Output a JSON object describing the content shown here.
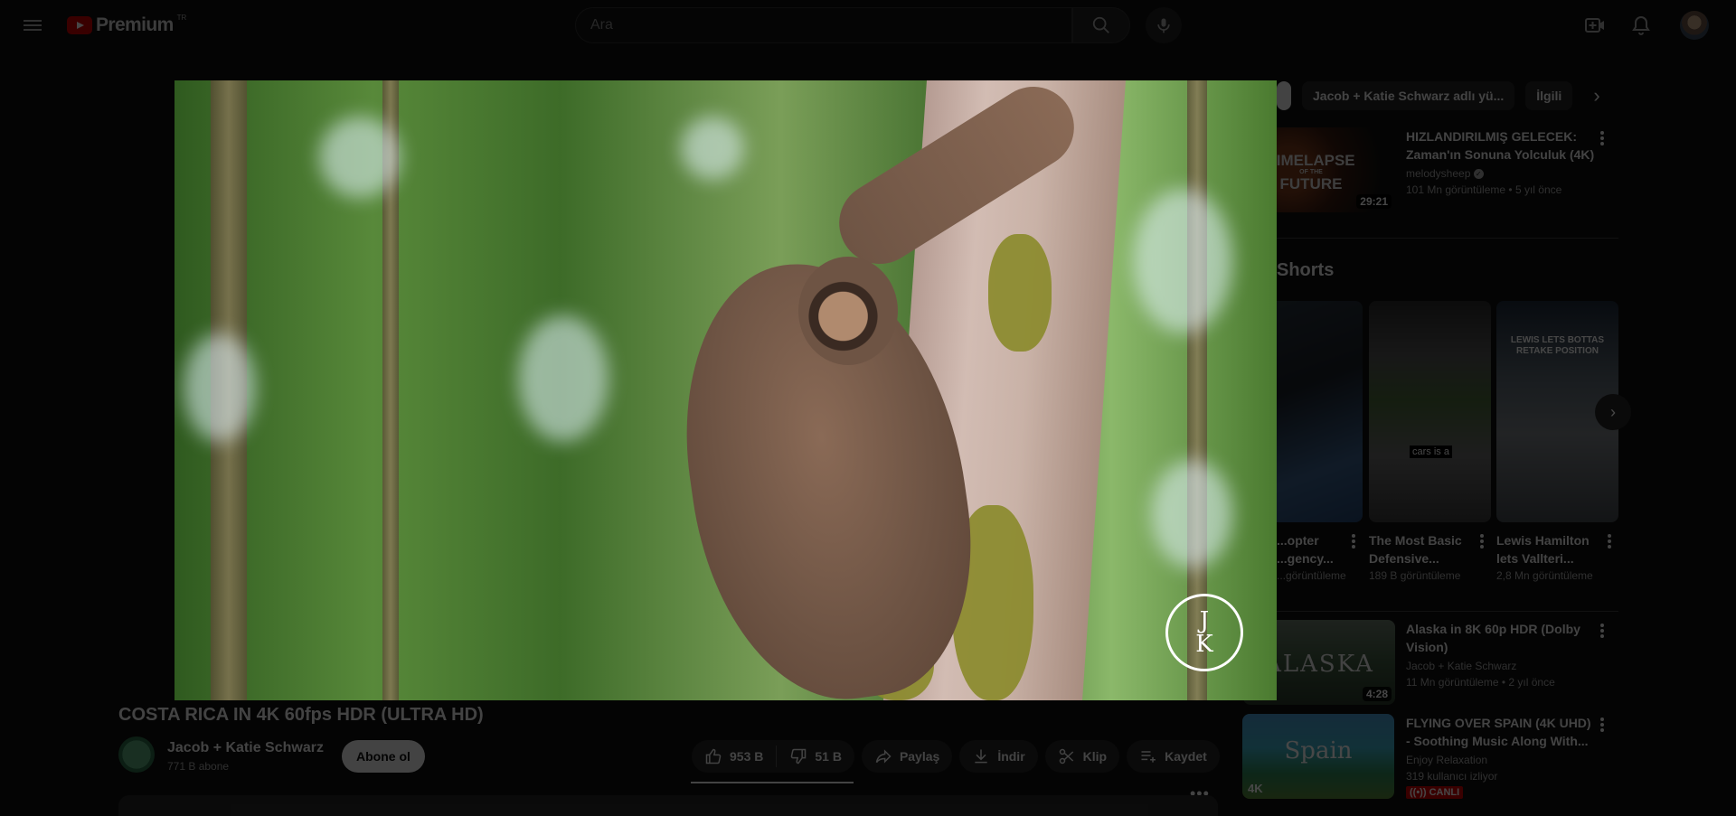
{
  "header": {
    "logo_text": "Premium",
    "logo_country": "TR",
    "search_placeholder": "Ara",
    "icons": [
      "menu-icon",
      "search-icon",
      "mic-icon",
      "create-icon",
      "bell-icon",
      "avatar"
    ]
  },
  "chips": [
    "Jacob + Katie Schwarz adlı yü...",
    "İlgili"
  ],
  "recommendations": [
    {
      "title": "HIZLANDIRILMIŞ GELECEK: Zaman'ın Sonuna Yolculuk (4K)",
      "thumb_text_1": "TIMELAPSE",
      "thumb_text_2": "OF THE",
      "thumb_text_3": "FUTURE",
      "channel": "melodysheep",
      "verified": true,
      "views": "101 Mn görüntüleme",
      "age": "5 yıl önce",
      "duration": "29:21"
    },
    {
      "title": "Alaska in 8K 60p HDR (Dolby Vision)",
      "thumb_text": "ALASKA",
      "channel": "Jacob + Katie Schwarz",
      "views": "11 Mn görüntüleme",
      "age": "2 yıl önce",
      "duration": "4:28"
    },
    {
      "title": "FLYING OVER SPAIN (4K UHD) - Soothing Music Along With...",
      "thumb_text": "Spain",
      "thumb_badge": "4K",
      "channel": "Enjoy Relaxation",
      "viewers": "319 kullanıcı izliyor",
      "live_label": "CANLI"
    }
  ],
  "shorts": {
    "section_title": "Shorts",
    "items": [
      {
        "title": "...opter ...gency...",
        "meta": "...görüntüleme"
      },
      {
        "title": "The Most Basic Defensive...",
        "meta": "189 B görüntüleme",
        "thumb_text": "cars is a"
      },
      {
        "title": "Lewis Hamilton lets Vallteri...",
        "meta": "2,8 Mn görüntüleme",
        "thumb_text": "LEWIS LETS BOTTAS RETAKE POSITION"
      }
    ]
  },
  "video": {
    "title": "COSTA RICA IN 4K 60fps HDR (ULTRA HD)",
    "channel_name": "Jacob + Katie Schwarz",
    "subscribers": "771 B abone",
    "subscribe_label": "Abone ol",
    "likes": "953 B",
    "dislikes": "51 B",
    "share_label": "Paylaş",
    "download_label": "İndir",
    "clip_label": "Klip",
    "save_label": "Kaydet",
    "watermark_top": "J",
    "watermark_bottom": "K"
  },
  "colors": {
    "background": "#0f0f0f",
    "chip_bg": "#272727",
    "live_red": "#cc0000",
    "logo_red": "#cc0000"
  }
}
